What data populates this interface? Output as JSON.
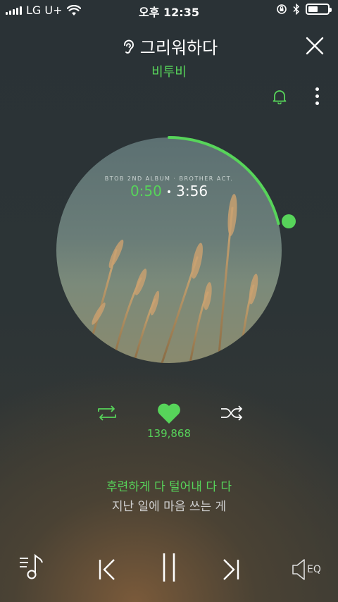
{
  "status_bar": {
    "carrier": "LG U+",
    "time": "오후 12:35",
    "battery_level": 0.5
  },
  "header": {
    "title": "그리워하다",
    "artist": "비투비"
  },
  "player": {
    "album_caption": "BTOB 2ND ALBUM · BROTHER ACT.",
    "current_time": "0:50",
    "separator": "•",
    "total_time": "3:56",
    "progress": 0.212,
    "like_count": "139,868"
  },
  "lyrics": {
    "current": "후련하게 다 털어내 다 다",
    "next": "지난 일에 마음 쓰는 게"
  },
  "bottom_bar": {
    "eq_label": "EQ"
  },
  "colors": {
    "accent": "#57d45a",
    "text": "#ffffff",
    "lyric_secondary": "#cfcfcf"
  }
}
